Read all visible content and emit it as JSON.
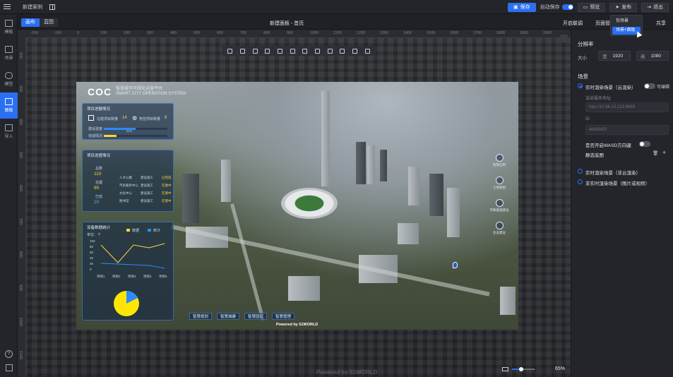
{
  "app": {
    "case_name": "新建案例",
    "save_label": "保存",
    "autosave_label": "自动保存",
    "preview_label": "预览",
    "publish_label": "发布",
    "exit_label": "退出"
  },
  "publish_menu": {
    "items": [
      "仅场景",
      "场景+面板"
    ],
    "selected": "场景+面板"
  },
  "leftrail": {
    "items": [
      {
        "label": "模板",
        "icon": "folder-icon"
      },
      {
        "label": "场景",
        "icon": "building-icon"
      },
      {
        "label": "模型",
        "icon": "cube-icon"
      },
      {
        "label": "面板",
        "icon": "panel-icon",
        "active": true
      },
      {
        "label": "导入",
        "icon": "import-icon"
      }
    ],
    "help_label": "?"
  },
  "subbar": {
    "tabs": [
      "画布",
      "蓝图"
    ],
    "active_tab": "画布",
    "page_title": "新建面板 - 首页",
    "right_items": [
      "开启联调",
      "页面管理",
      "共享"
    ]
  },
  "ruler": {
    "h_ticks": [
      "-200",
      "-100",
      "0",
      "100",
      "200",
      "300",
      "400",
      "500",
      "600",
      "700",
      "800",
      "900",
      "1000",
      "1100",
      "1200",
      "1300",
      "1400",
      "1500",
      "1600",
      "1700",
      "1800",
      "1900",
      "2000"
    ],
    "v_ticks": [
      "200",
      "300",
      "400",
      "500",
      "600",
      "700",
      "800",
      "900",
      "1000",
      "1100"
    ]
  },
  "scene": {
    "logo": "COC",
    "brand_cn": "智慧城市可视化运营平台",
    "brand_en": "SMART CITY OPERATION SYSTEM",
    "panel1": {
      "title": "项目进展情况",
      "stat1_label": "在建项目数量",
      "stat1_value": "14",
      "stat2_label": "管控项目数量",
      "stat2_value": "8",
      "row1": "建设进度",
      "row2": "完成情况",
      "row1_progress": 0.5,
      "row2_progress": 0.2,
      "row1_pct": "50%"
    },
    "panel2": {
      "title": "项目进度情况",
      "items": [
        {
          "label": "总数",
          "value": "110"
        },
        {
          "label": "在建",
          "value": "90"
        },
        {
          "label": "已完",
          "value": "20"
        }
      ],
      "table": [
        [
          "人才公寓",
          "建设施工",
          "已完成"
        ],
        [
          "市民服务中心",
          "建设施工",
          "在建中"
        ],
        [
          "文化中心",
          "建设施工",
          "在建中"
        ],
        [
          "图书馆",
          "建设施工",
          "在建中"
        ]
      ]
    },
    "panel3": {
      "title": "设备数据统计",
      "legend": [
        "数据",
        "统计"
      ],
      "unit": "单位：个",
      "y_ticks": [
        "100",
        "80",
        "60",
        "40",
        "20",
        "0"
      ],
      "x_ticks": [
        "项目1",
        "项目2",
        "项目3",
        "项目4",
        "项目5"
      ]
    },
    "right_icons": [
      "智慧应用",
      "土地规划",
      "市政基础建设",
      "生态建设"
    ],
    "bottom_tabs": [
      "智慧规划",
      "智慧城建",
      "智慧园区",
      "智慧管理"
    ],
    "powered": "Powered by 51WORLD"
  },
  "canvas_watermark": "Powered by 51WORLD",
  "zoom": {
    "value": "65%",
    "slider_level": 0.35
  },
  "rightpanel": {
    "resolution_title": "分辨率",
    "size_label": "大小",
    "width_key": "宽",
    "width_value": "1920",
    "height_key": "高",
    "height_value": "1080",
    "scene_title": "场景",
    "option1": "实时渲染场景（云渲染）",
    "editable_label": "可编辑",
    "server_label": "渲染服务地址",
    "server_placeholder": "http://10.66.12.123:8889",
    "id_label": "ID",
    "id_placeholder": "4e943d2f",
    "wasd_label": "是否开启WASD方向键",
    "static_bg_label": "静态底图",
    "option2": "实时渲染场景（非云渲染）",
    "option3": "非实时渲染场景（图片或视频）"
  }
}
